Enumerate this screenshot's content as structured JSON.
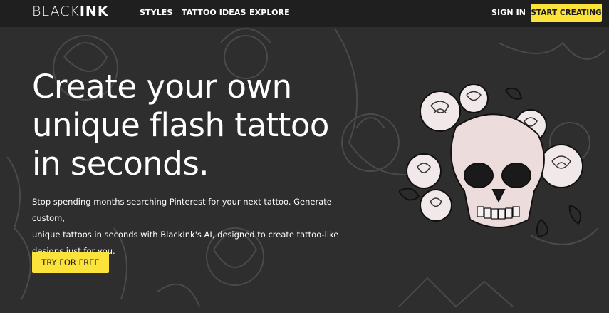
{
  "header": {
    "logo_light": "BLACK",
    "logo_bold": "INK",
    "nav": [
      {
        "label": "STYLES"
      },
      {
        "label": "TATTOO IDEAS"
      },
      {
        "label": "EXPLORE"
      }
    ],
    "sign_in_label": "SIGN IN",
    "start_creating_label": "START CREATING"
  },
  "hero": {
    "title_line1": "Create your own",
    "title_line2": "unique flash tattoo",
    "title_line3": "in seconds.",
    "subtitle_line1": "Stop spending months searching Pinterest for your next tattoo. Generate custom,",
    "subtitle_line2": "unique tattoos in seconds with BlackInk's AI, designed to create tattoo-like",
    "subtitle_line3": "designs just for you.",
    "cta_label": "TRY FOR FREE"
  },
  "colors": {
    "background": "#2e2e2e",
    "nav_background": "#1f1f1f",
    "accent": "#fbe33b",
    "text": "#ffffff"
  },
  "icons": {
    "hero_image": "skull-with-roses-tattoo-illustration"
  }
}
